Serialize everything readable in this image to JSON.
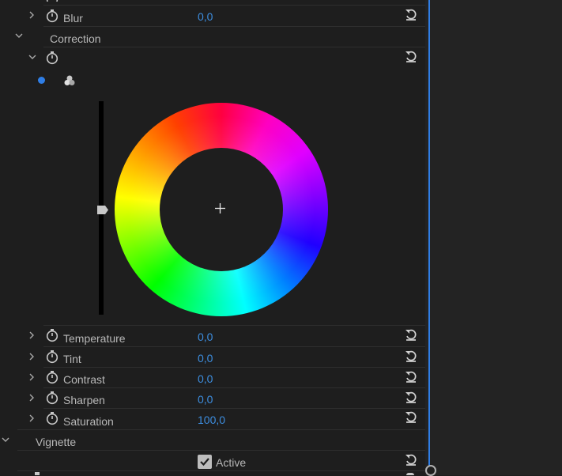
{
  "rows": {
    "blur": {
      "label": "Blur",
      "value": "0,0"
    },
    "correction": {
      "label": "Correction"
    },
    "temperature": {
      "label": "Temperature",
      "value": "0,0"
    },
    "tint": {
      "label": "Tint",
      "value": "0,0"
    },
    "contrast": {
      "label": "Contrast",
      "value": "0,0"
    },
    "sharpen": {
      "label": "Sharpen",
      "value": "0,0"
    },
    "saturation": {
      "label": "Saturation",
      "value": "100,0"
    },
    "vignette": {
      "label": "Vignette"
    },
    "vignette_active": {
      "label": "Active",
      "checked": true
    }
  },
  "colors": {
    "value_text": "#3d8ee0",
    "playhead": "#2f7ee6",
    "mode_dot": "#2f7ee6"
  },
  "icons": {
    "expand": "chevron-right-icon",
    "collapse": "chevron-down-icon",
    "keyframe": "stopwatch-icon",
    "reset": "reset-icon",
    "wheel_mode": "three-circles-icon"
  }
}
